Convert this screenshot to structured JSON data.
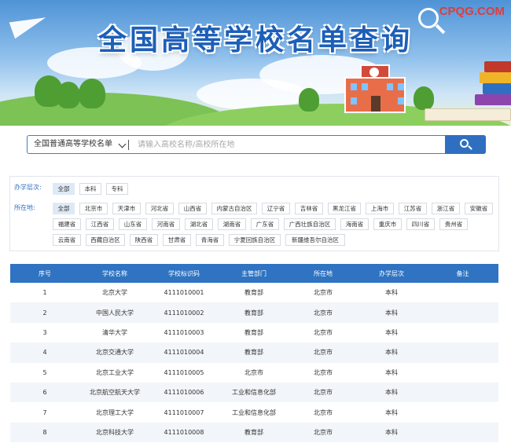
{
  "header": {
    "title": "全国高等学校名单查询",
    "brand": "CPQG.COM"
  },
  "search": {
    "select_value": "全国普通高等学校名单",
    "placeholder": "请输入高校名称/高校所在地",
    "button_icon": "search-icon"
  },
  "filters": {
    "level_label": "办学层次:",
    "levels": [
      "全部",
      "本科",
      "专科"
    ],
    "location_label": "所在地:",
    "locations": [
      "全部",
      "北京市",
      "天津市",
      "河北省",
      "山西省",
      "内蒙古自治区",
      "辽宁省",
      "吉林省",
      "黑龙江省",
      "上海市",
      "江苏省",
      "浙江省",
      "安徽省",
      "福建省",
      "江西省",
      "山东省",
      "河南省",
      "湖北省",
      "湖南省",
      "广东省",
      "广西壮族自治区",
      "海南省",
      "重庆市",
      "四川省",
      "贵州省",
      "云南省",
      "西藏自治区",
      "陕西省",
      "甘肃省",
      "青海省",
      "宁夏回族自治区",
      "新疆维吾尔自治区"
    ]
  },
  "table": {
    "headers": [
      "序号",
      "学校名称",
      "学校标识码",
      "主管部门",
      "所在地",
      "办学层次",
      "备注"
    ],
    "rows": [
      [
        "1",
        "北京大学",
        "4111010001",
        "教育部",
        "北京市",
        "本科",
        ""
      ],
      [
        "2",
        "中国人民大学",
        "4111010002",
        "教育部",
        "北京市",
        "本科",
        ""
      ],
      [
        "3",
        "清华大学",
        "4111010003",
        "教育部",
        "北京市",
        "本科",
        ""
      ],
      [
        "4",
        "北京交通大学",
        "4111010004",
        "教育部",
        "北京市",
        "本科",
        ""
      ],
      [
        "5",
        "北京工业大学",
        "4111010005",
        "北京市",
        "北京市",
        "本科",
        ""
      ],
      [
        "6",
        "北京航空航天大学",
        "4111010006",
        "工业和信息化部",
        "北京市",
        "本科",
        ""
      ],
      [
        "7",
        "北京理工大学",
        "4111010007",
        "工业和信息化部",
        "北京市",
        "本科",
        ""
      ],
      [
        "8",
        "北京科技大学",
        "4111010008",
        "教育部",
        "北京市",
        "本科",
        ""
      ]
    ]
  }
}
